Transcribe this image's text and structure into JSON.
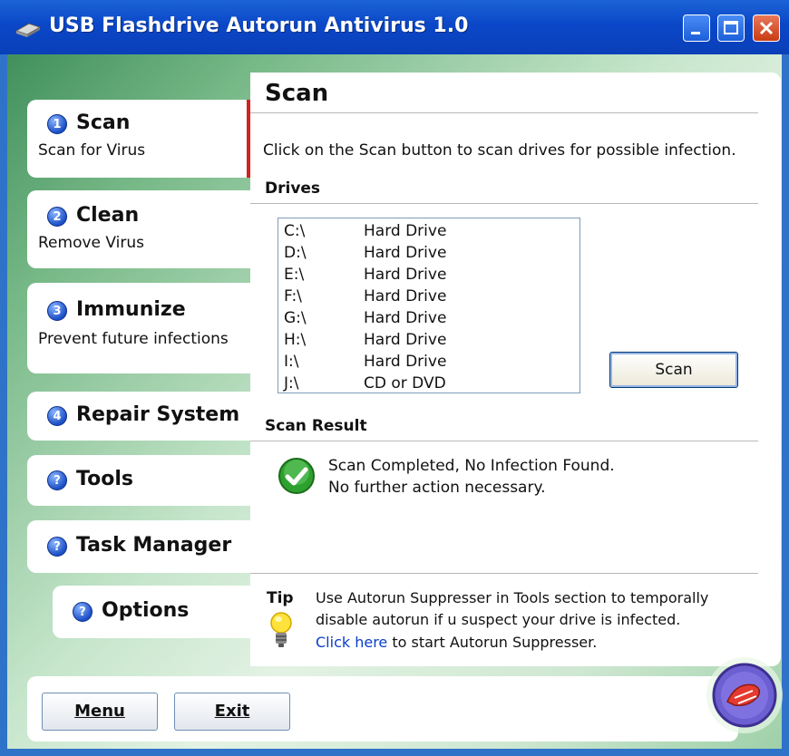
{
  "window": {
    "title": "USB Flashdrive Autorun Antivirus 1.0",
    "minimize_icon": "minimize-icon",
    "maximize_icon": "maximize-icon",
    "close_icon": "close-icon"
  },
  "sidebar": {
    "items": [
      {
        "number": "1",
        "label": "Scan",
        "sub": "Scan for Virus",
        "active": true
      },
      {
        "number": "2",
        "label": "Clean",
        "sub": "Remove Virus"
      },
      {
        "number": "3",
        "label": "Immunize",
        "sub": "Prevent future infections"
      },
      {
        "number": "4",
        "label": "Repair System"
      },
      {
        "number": "?",
        "label": "Tools"
      },
      {
        "number": "?",
        "label": "Task Manager"
      },
      {
        "number": "?",
        "label": "Options"
      }
    ]
  },
  "main": {
    "title": "Scan",
    "intro": "Click on the Scan button to scan drives for possible infection.",
    "drives_heading": "Drives",
    "drives": [
      {
        "letter": "C:\\",
        "type": "Hard Drive"
      },
      {
        "letter": "D:\\",
        "type": "Hard Drive"
      },
      {
        "letter": "E:\\",
        "type": "Hard Drive"
      },
      {
        "letter": "F:\\",
        "type": "Hard Drive"
      },
      {
        "letter": "G:\\",
        "type": "Hard Drive"
      },
      {
        "letter": "H:\\",
        "type": "Hard Drive"
      },
      {
        "letter": "I:\\",
        "type": "Hard Drive"
      },
      {
        "letter": "J:\\",
        "type": "CD or DVD"
      }
    ],
    "scan_button": "Scan",
    "result_heading": "Scan Result",
    "result_line1": "Scan Completed, No Infection Found.",
    "result_line2": "No further action necessary.",
    "tip_label": "Tip",
    "tip_line1": "Use Autorun Suppresser in Tools section to temporally",
    "tip_line2": "disable autorun if u suspect your drive is infected.",
    "tip_link": "Click here",
    "tip_line3_rest": " to start Autorun Suppresser."
  },
  "bottom": {
    "menu_button": "Menu",
    "exit_button": "Exit"
  },
  "colors": {
    "titlebar": "#0a47c8",
    "active_marker": "#d3221f",
    "link": "#0a3ec8",
    "check": "#2ea02e"
  }
}
